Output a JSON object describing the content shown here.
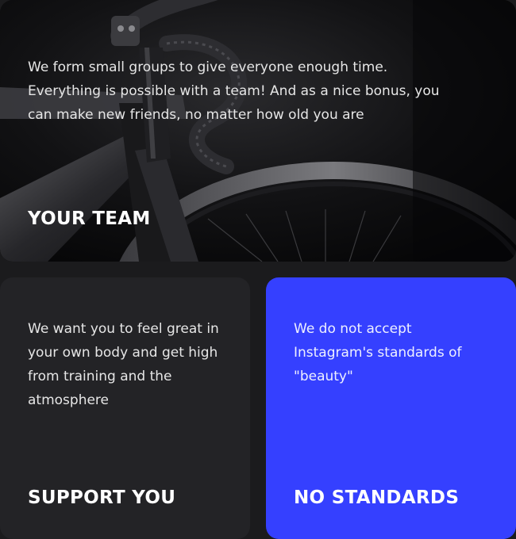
{
  "cards": [
    {
      "title": "YOUR TEAM",
      "text": "We form small groups to give everyone enough time. Everything is possible with a team!  And as a nice bonus, you can make new friends, no matter how old you are",
      "background": "#0b0b0c",
      "image": "bicycle-photo"
    },
    {
      "title": "SUPPORT YOU",
      "text": "We want you to feel great in your own body and get high from training and the atmosphere",
      "background": "#232326"
    },
    {
      "title": "NO STANDARDS",
      "text": "We do not accept Instagram's standards of \"beauty\"",
      "background": "#3540ff"
    }
  ]
}
